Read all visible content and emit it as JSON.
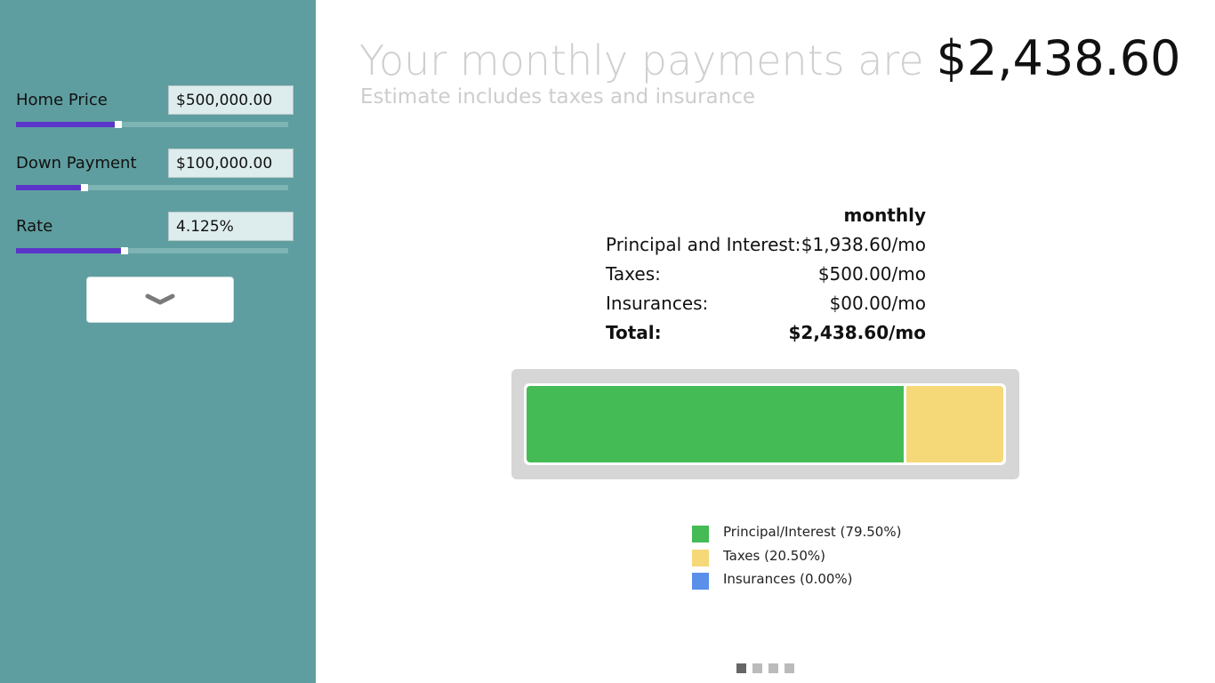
{
  "sidebar": {
    "fields": [
      {
        "label": "Home Price",
        "value": "$500,000.00",
        "slider_fraction": 0.375
      },
      {
        "label": "Down Payment",
        "value": "$100,000.00",
        "slider_fraction": 0.25
      },
      {
        "label": "Rate",
        "value": "4.125%",
        "slider_fraction": 0.4
      }
    ],
    "expand_icon": "chevron-down-icon"
  },
  "main": {
    "headline_prefix": "Your monthly payments are",
    "headline_amount": "$2,438.60",
    "subtitle": "Estimate includes taxes and insurance",
    "breakdown": {
      "column_header": "monthly",
      "rows": [
        {
          "label": "Principal and Interest:",
          "value": "$1,938.60/mo"
        },
        {
          "label": "Taxes:",
          "value": "$500.00/mo"
        },
        {
          "label": "Insurances:",
          "value": "$00.00/mo"
        }
      ],
      "total_label": "Total:",
      "total_value": "$2,438.60/mo"
    },
    "bar": {
      "segments": [
        {
          "name": "principal",
          "fraction": 0.795,
          "color": "#44bb55"
        },
        {
          "name": "taxes",
          "fraction": 0.205,
          "color": "#f5d878"
        },
        {
          "name": "insurances",
          "fraction": 0.0,
          "color": "#5b8fea"
        }
      ]
    },
    "legend": [
      {
        "label": "Principal/Interest (79.50%)",
        "color": "#44bb55"
      },
      {
        "label": "Taxes (20.50%)",
        "color": "#f5d878"
      },
      {
        "label": "Insurances (0.00%)",
        "color": "#5b8fea"
      }
    ],
    "pager": {
      "count": 4,
      "active": 0
    }
  },
  "colors": {
    "sidebar_bg": "#5f9ea0",
    "slider_fill": "#5b34c9",
    "accent_text": "#111111"
  }
}
